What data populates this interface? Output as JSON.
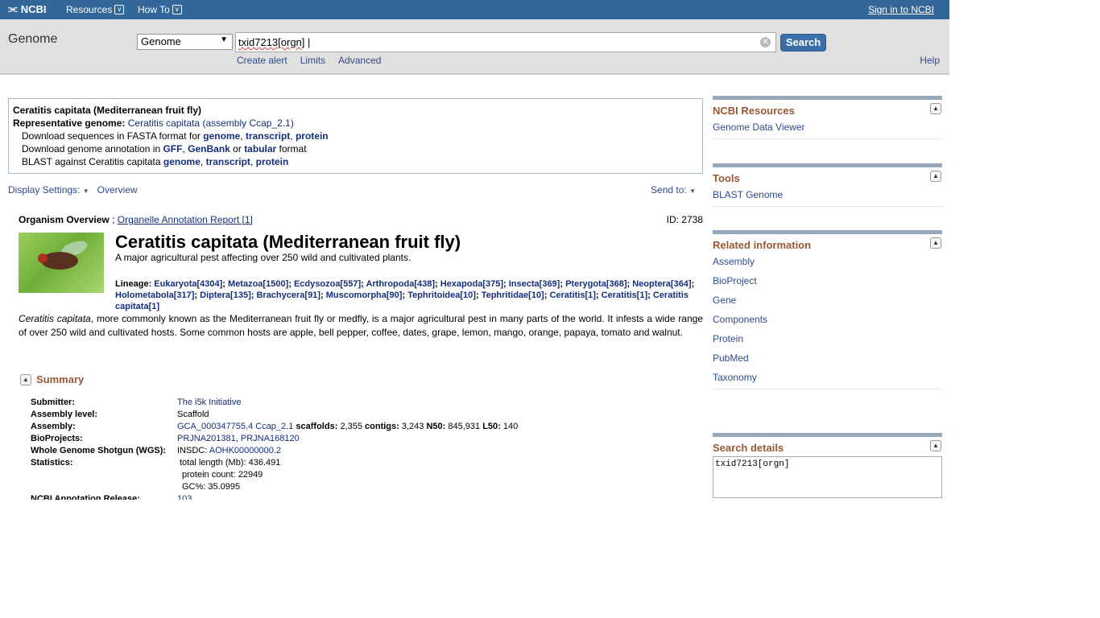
{
  "topbar": {
    "logo": "NCBI",
    "resources": "Resources",
    "howto": "How To",
    "signin": "Sign in to NCBI"
  },
  "search": {
    "db_name": "Genome",
    "db_select": "Genome",
    "term": "txid7213[orgn]",
    "button": "Search",
    "links": [
      "Create alert",
      "Limits",
      "Advanced"
    ],
    "help": "Help"
  },
  "infobox": {
    "line1": "Ceratitis capitata (Mediterranean fruit fly)",
    "rep_label": "Representative genome:",
    "rep_link": "Ceratitis capitata (assembly Ccap_2.1)",
    "dl_seq_text": "Download sequences in FASTA format for",
    "dl_seq_links": [
      "genome",
      "transcript",
      "protein"
    ],
    "dl_ann_text": "Download genome annotation in",
    "dl_ann_gff": "GFF",
    "dl_ann_genbank": "GenBank",
    "dl_ann_or": "or",
    "dl_ann_tabular": "tabular",
    "dl_ann_format": "format",
    "blast_text": "BLAST against Ceratitis capitata",
    "blast_links": [
      "genome",
      "transcript",
      "protein"
    ]
  },
  "display": {
    "settings": "Display Settings:",
    "overview": "Overview",
    "sendto": "Send to:"
  },
  "organism": {
    "overview_label": "Organism Overview",
    "sep": ";",
    "organelle_link": "Organelle Annotation Report [1]",
    "id": "ID: 2738",
    "title": "Ceratitis capitata (Mediterranean fruit fly)",
    "subtitle": "A major agricultural pest affecting over 250 wild and cultivated plants.",
    "lineage_label": "Lineage:",
    "lineage": [
      "Eukaryota[4304]",
      "Metazoa[1500]",
      "Ecdysozoa[557]",
      "Arthropoda[438]",
      "Hexapoda[375]",
      "Insecta[369]",
      "Pterygota[368]",
      "Neoptera[364]",
      "Holometabola[317]",
      "Diptera[135]",
      "Brachycera[91]",
      "Muscomorpha[90]",
      "Tephritoidea[10]",
      "Tephritidae[10]",
      "Ceratitis[1]",
      "Ceratitis[1]",
      "Ceratitis capitata[1]"
    ],
    "desc_italic": "Ceratitis capitata",
    "desc_rest": ", more commonly known as the Mediterranean fruit fly or medfly, is a major agricultural pest in many parts of the world. It infests a wide range of over 250 wild and cultivated hosts. Some common hosts are apple, bell pepper, coffee, dates, grape, lemon, mango, orange, papaya, tomato and walnut."
  },
  "summary": {
    "header": "Summary",
    "submitter_k": "Submitter:",
    "submitter_v": "The i5k Initiative",
    "level_k": "Assembly level:",
    "level_v": "Scaffold",
    "assembly_k": "Assembly:",
    "assembly_link": "GCA_000347755.4 Ccap_2.1",
    "scaffolds_k": "scaffolds:",
    "scaffolds_v": "2,355",
    "contigs_k": "contigs:",
    "contigs_v": "3,243",
    "n50_k": "N50:",
    "n50_v": "845,931",
    "l50_k": "L50:",
    "l50_v": "140",
    "bioprojects_k": "BioProjects:",
    "bioprojects_v": [
      "PRJNA201381",
      "PRJNA168120"
    ],
    "wgs_k": "Whole Genome Shotgun (WGS):",
    "wgs_prefix": "INSDC:",
    "wgs_link": "AOHK00000000.2",
    "stats_k": "Statistics:",
    "stats_v": [
      "total length (Mb): 436.491",
      "protein count: 22949",
      "GC%: 35.0995"
    ],
    "annot_k": "NCBI Annotation Release:",
    "annot_v": "103"
  },
  "sidebar": {
    "ncbi_resources": {
      "title": "NCBI Resources",
      "items": [
        "Genome Data Viewer"
      ]
    },
    "tools": {
      "title": "Tools",
      "items": [
        "BLAST Genome"
      ]
    },
    "related": {
      "title": "Related information",
      "items": [
        "Assembly",
        "BioProject",
        "Gene",
        "Components",
        "Protein",
        "PubMed",
        "Taxonomy"
      ]
    },
    "search_details": {
      "title": "Search details",
      "text": "txid7213[orgn]"
    }
  }
}
